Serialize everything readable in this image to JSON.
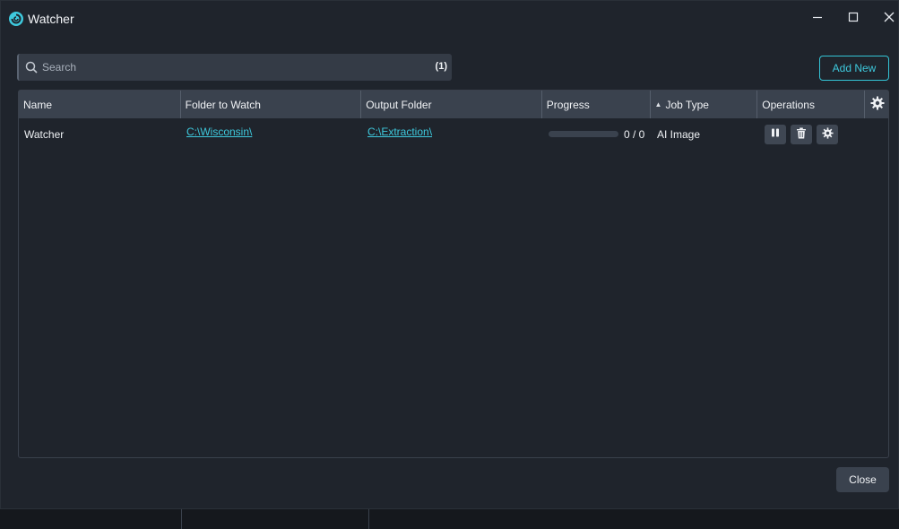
{
  "window": {
    "title": "Watcher",
    "minimize_icon": "minimize-icon",
    "maximize_icon": "maximize-icon",
    "close_icon": "close-icon"
  },
  "search": {
    "placeholder": "Search",
    "value": "",
    "count": "(1)"
  },
  "toolbar": {
    "add_new_label": "Add New"
  },
  "table": {
    "columns": [
      {
        "key": "name",
        "label": "Name"
      },
      {
        "key": "folder",
        "label": "Folder to Watch"
      },
      {
        "key": "output",
        "label": "Output Folder"
      },
      {
        "key": "progress",
        "label": "Progress"
      },
      {
        "key": "job_type",
        "label": "Job Type",
        "sorted": "ascending"
      },
      {
        "key": "operations",
        "label": "Operations"
      }
    ],
    "settings_icon": "gear-icon",
    "rows": [
      {
        "name": "Watcher",
        "folder": "C:\\Wisconsin\\",
        "output": "C:\\Extraction\\",
        "progress_fraction": 0,
        "progress_text": "0 / 0",
        "job_type": "AI Image",
        "operations": [
          "pause-icon",
          "trash-icon",
          "gear-icon"
        ]
      }
    ]
  },
  "footer": {
    "close_label": "Close"
  },
  "colors": {
    "accent": "#3ec9dd",
    "window_bg": "#1f242c",
    "header_bg": "#3a424e"
  }
}
